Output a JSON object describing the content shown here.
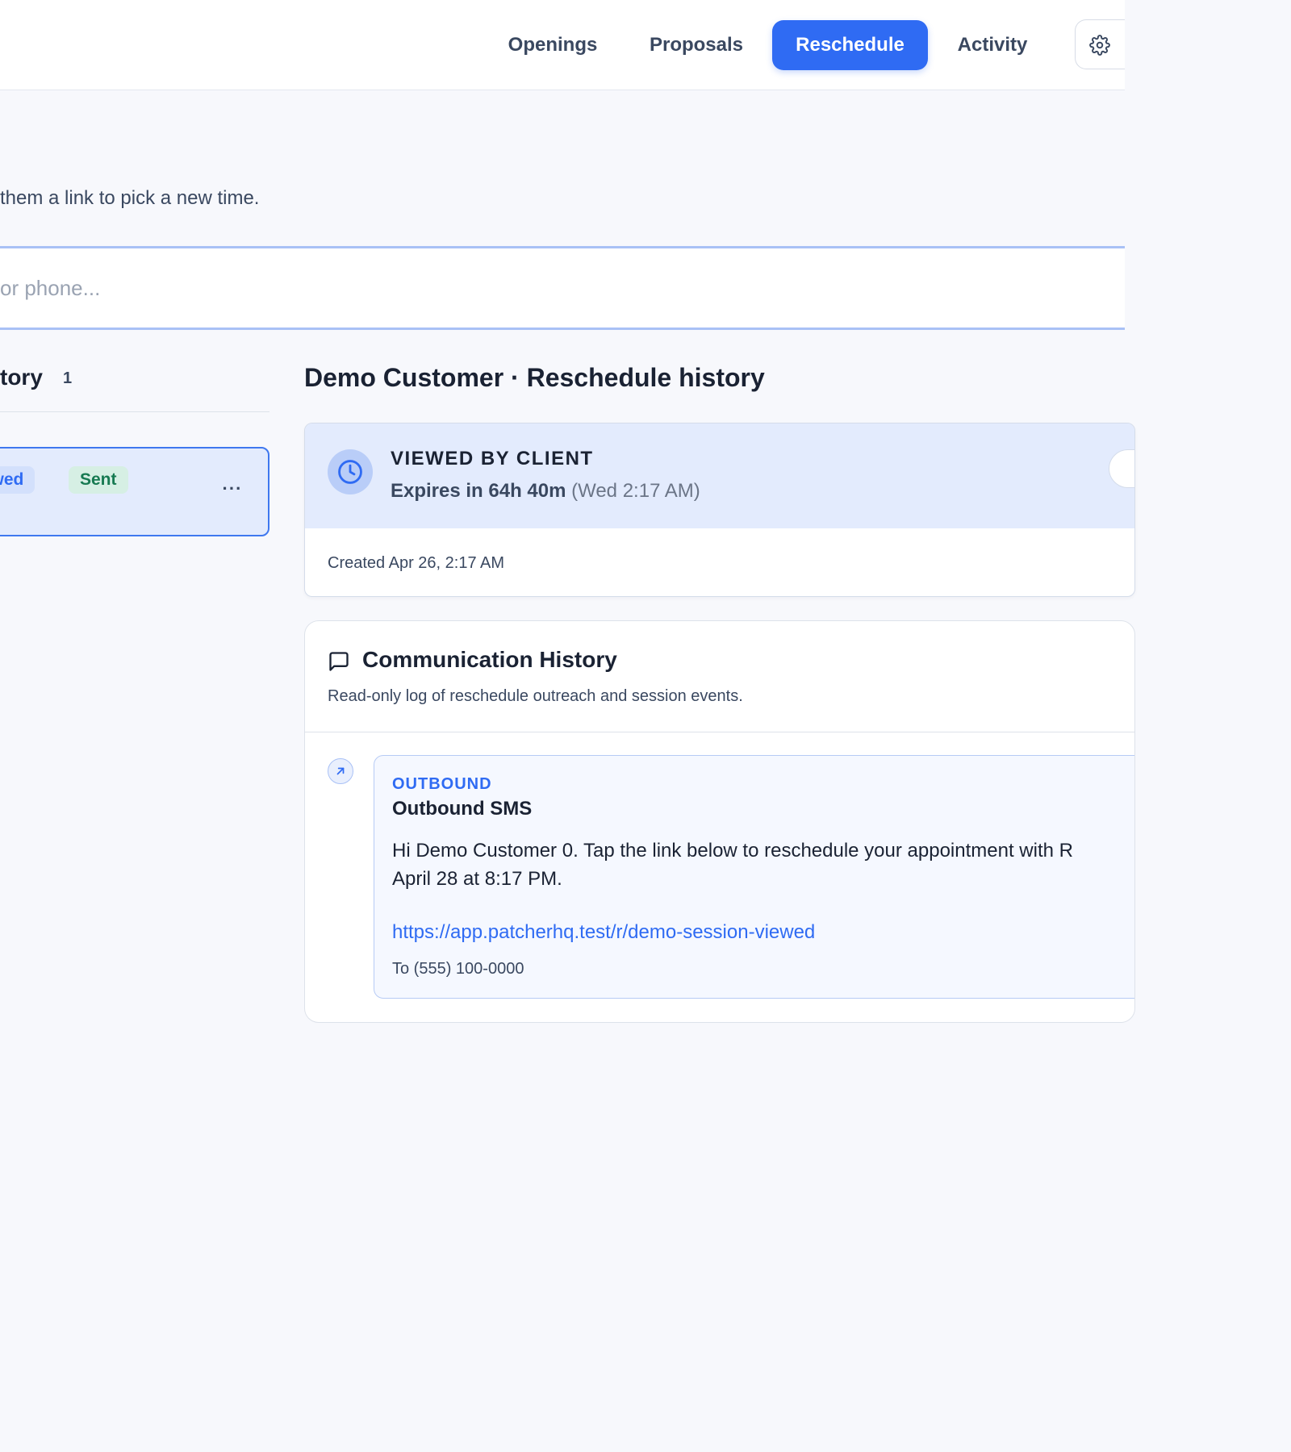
{
  "nav": {
    "tabs": [
      {
        "label": "Openings"
      },
      {
        "label": "Proposals"
      },
      {
        "label": "Reschedule",
        "active": true
      },
      {
        "label": "Activity"
      }
    ],
    "settings_icon": "gear-icon"
  },
  "page": {
    "subtitle": "them a link to pick a new time."
  },
  "search": {
    "placeholder": "or phone..."
  },
  "list": {
    "header": "tory",
    "count": "1",
    "items": [
      {
        "badges": [
          {
            "label": "iewed",
            "color": "#2f6bf3"
          },
          {
            "label": "Sent",
            "color": "#177a52"
          }
        ],
        "more": "···"
      }
    ]
  },
  "detail": {
    "title": "Demo Customer · Reschedule history",
    "status": {
      "icon": "clock-icon",
      "label": "VIEWED BY CLIENT",
      "expires": "Expires in 64h 40m",
      "expires_at": "(Wed 2:17 AM)",
      "created": "Created Apr 26, 2:17 AM"
    },
    "communication": {
      "icon": "message-square-icon",
      "title": "Communication History",
      "description": "Read-only log of reschedule outreach and session events.",
      "entries": [
        {
          "icon": "arrow-up-right-icon",
          "direction": "OUTBOUND",
          "title": "Outbound SMS",
          "body_line1": "Hi Demo Customer 0. Tap the link below to reschedule your appointment with R",
          "body_line2": "April 28 at 8:17 PM.",
          "link": "https://app.patcherhq.test/r/demo-session-viewed",
          "to": "To (555) 100-0000"
        }
      ]
    }
  },
  "colors": {
    "accent": "#2f6bf3",
    "selected_bg": "#e3ebfd",
    "sent_green": "#177a52",
    "page_bg": "#f7f8fc"
  }
}
